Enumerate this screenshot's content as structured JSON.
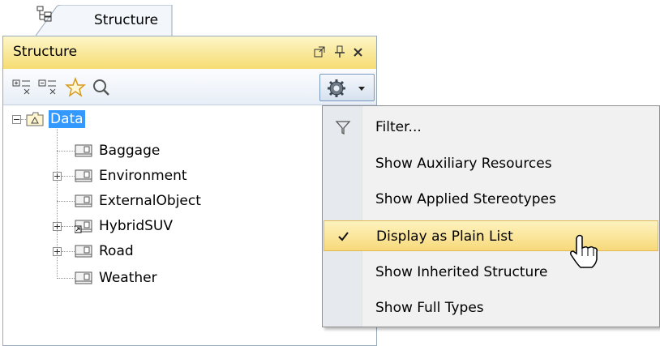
{
  "tab": {
    "label": "Structure",
    "icon": "structure-icon"
  },
  "panel": {
    "title": "Structure",
    "header_buttons": [
      "float-icon",
      "pin-icon",
      "close-icon"
    ],
    "toolbar_buttons": [
      "expand-all-icon",
      "collapse-all-icon",
      "star-icon",
      "search-icon",
      "settings-gear-icon"
    ]
  },
  "tree": {
    "root": {
      "label": "Data",
      "expanded": true,
      "selected": true
    },
    "children": [
      {
        "label": "Baggage",
        "expandable": false
      },
      {
        "label": "Environment",
        "expandable": true
      },
      {
        "label": "ExternalObject",
        "expandable": false
      },
      {
        "label": "HybridSUV",
        "expandable": true
      },
      {
        "label": "Road",
        "expandable": true
      },
      {
        "label": "Weather",
        "expandable": false
      }
    ]
  },
  "menu": {
    "items": [
      {
        "label": "Filter...",
        "icon": "filter-icon"
      },
      {
        "label": "Show Auxiliary Resources"
      },
      {
        "label": "Show Applied Stereotypes"
      },
      {
        "label": "Display as Plain List",
        "checked": true,
        "highlighted": true
      },
      {
        "label": "Show Inherited Structure"
      },
      {
        "label": "Show Full Types"
      }
    ]
  },
  "colors": {
    "selection": "#3399ff",
    "header": "#f6dc72",
    "menu_highlight": "#f7d97a"
  }
}
